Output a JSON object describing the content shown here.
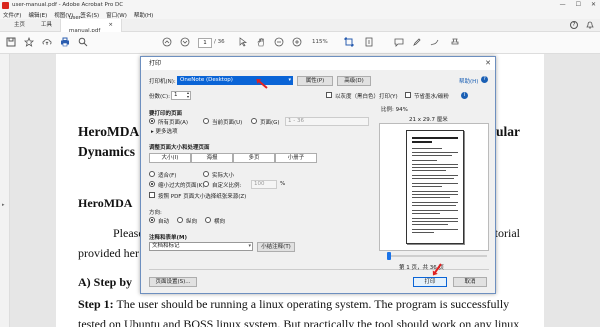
{
  "window": {
    "title": "user-manual.pdf - Adobe Acrobat Pro DC",
    "controls": [
      "—",
      "☐",
      "✕"
    ]
  },
  "menu": [
    "文件(F)",
    "编辑(E)",
    "视图(V)",
    "签名(S)",
    "窗口(W)",
    "帮助(H)"
  ],
  "tabs": {
    "home": "主页",
    "tools": "工具",
    "document": "user-manual.pdf",
    "doc_close": "×"
  },
  "tabbar_right": {
    "help_icon": "?",
    "bell_icon": "🔔"
  },
  "toolbar": {
    "page_current": "1",
    "page_total": "/ 36",
    "zoom": "115%"
  },
  "document": {
    "title_line1_left": "HeroMDA",
    "title_line1_right": "ecular",
    "title_line2": "Dynamics",
    "heading": "HeroMDA",
    "para1_left": "Please",
    "para1_right": "tutorial",
    "para2": "provided her",
    "step_heading": "A)  Step by",
    "step1_label": "Step 1:",
    "step1_text": " The user should be running a linux operating system. The program is successfully",
    "step1_line2": "tested on Ubuntu and BOSS linux system. But practically the tool should work on any linux"
  },
  "dialog": {
    "title": "打印",
    "close": "✕",
    "printer_label": "打印机(N):",
    "printer_value": "OneNote (Desktop)",
    "properties_btn": "属性(P)",
    "advanced_btn": "高级(D)",
    "help_link": "帮助(H)",
    "copies_label": "份数(C):",
    "copies_value": "1",
    "grayscale_label": "以灰度（黑白色）打印(Y)",
    "save_ink_label": "节省墨水/碳粉",
    "pages_section": "要打印的页面",
    "all_pages": "所有页面(A)",
    "current_page": "当前页面(U)",
    "pages_range": "页面(G)",
    "pages_range_value": "1 - 36",
    "more_options": "▸ 更多选项",
    "sizing_section": "调整页面大小和处理页面",
    "sizing_buttons": [
      "大小(I)",
      "海报",
      "多页",
      "小册子"
    ],
    "fit": "适合(F)",
    "actual_size": "实际大小",
    "shrink_oversized": "缩小过大的页面(K)",
    "custom_scale": "自定义比例:",
    "custom_scale_value": "100",
    "percent": "%",
    "paper_source_label": "按照 PDF 页面大小选择纸张来源(Z)",
    "orientation_section": "方向:",
    "orient_auto": "自动",
    "orient_portrait": "纵向",
    "orient_landscape": "横向",
    "comments_section": "注释和表单(M)",
    "comments_value": "文档和标记",
    "summarize_btn": "小结注释(T)",
    "scale_label": "比例:",
    "scale_value": "94%",
    "paper_size": "21 x 29.7 厘米",
    "page_indicator": "第 1 页，共 36 页",
    "page_setup_btn": "页面设置(S)...",
    "print_btn": "打印",
    "cancel_btn": "取消"
  },
  "colors": {
    "selection": "#0a64d6",
    "annotation_arrow": "#e02020"
  }
}
